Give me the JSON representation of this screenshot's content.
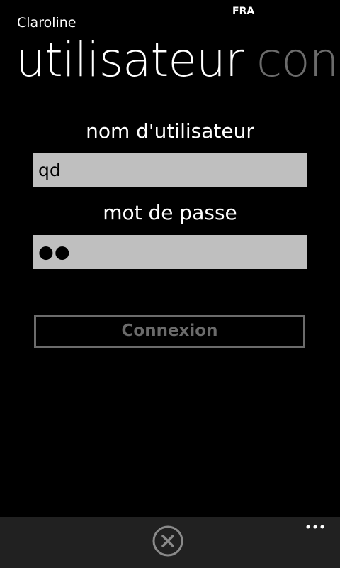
{
  "status_bar": {
    "language": "FRA"
  },
  "app": {
    "title": "Claroline"
  },
  "pivot": {
    "active_header": "utilisateur",
    "next_header": "conf"
  },
  "login_form": {
    "username_label": "nom d'utilisateur",
    "username_value": "qd",
    "password_label": "mot de passe",
    "password_masked": "●●",
    "connect_label": "Connexion"
  },
  "app_bar": {
    "close_icon": "close-circle-icon",
    "more_icon": "ellipsis-icon"
  }
}
